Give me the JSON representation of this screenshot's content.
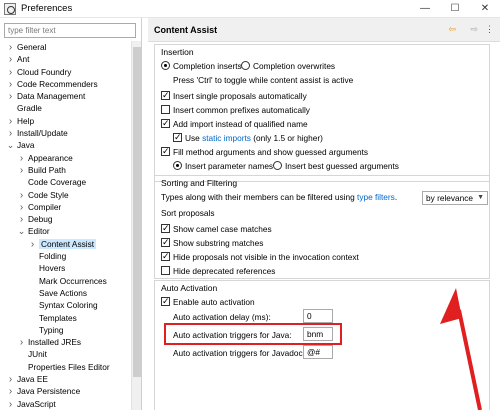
{
  "window": {
    "title": "Preferences",
    "minimize": "—",
    "maximize": "☐",
    "close": "✕"
  },
  "sidebar": {
    "filter_placeholder": "type filter text",
    "items": [
      {
        "label": "General",
        "arrow": "expand",
        "indent": 0
      },
      {
        "label": "Ant",
        "arrow": "expand",
        "indent": 0
      },
      {
        "label": "Cloud Foundry",
        "arrow": "expand",
        "indent": 0
      },
      {
        "label": "Code Recommenders",
        "arrow": "expand",
        "indent": 0
      },
      {
        "label": "Data Management",
        "arrow": "expand",
        "indent": 0
      },
      {
        "label": "Gradle",
        "arrow": "none",
        "indent": 0
      },
      {
        "label": "Help",
        "arrow": "expand",
        "indent": 0
      },
      {
        "label": "Install/Update",
        "arrow": "expand",
        "indent": 0
      },
      {
        "label": "Java",
        "arrow": "collapse",
        "indent": 0
      },
      {
        "label": "Appearance",
        "arrow": "expand",
        "indent": 1
      },
      {
        "label": "Build Path",
        "arrow": "expand",
        "indent": 1
      },
      {
        "label": "Code Coverage",
        "arrow": "none",
        "indent": 1
      },
      {
        "label": "Code Style",
        "arrow": "expand",
        "indent": 1
      },
      {
        "label": "Compiler",
        "arrow": "expand",
        "indent": 1
      },
      {
        "label": "Debug",
        "arrow": "expand",
        "indent": 1
      },
      {
        "label": "Editor",
        "arrow": "collapse",
        "indent": 1
      },
      {
        "label": "Content Assist",
        "arrow": "expand",
        "indent": 2,
        "selected": true
      },
      {
        "label": "Folding",
        "arrow": "none",
        "indent": 2
      },
      {
        "label": "Hovers",
        "arrow": "none",
        "indent": 2
      },
      {
        "label": "Mark Occurrences",
        "arrow": "none",
        "indent": 2
      },
      {
        "label": "Save Actions",
        "arrow": "none",
        "indent": 2
      },
      {
        "label": "Syntax Coloring",
        "arrow": "none",
        "indent": 2
      },
      {
        "label": "Templates",
        "arrow": "none",
        "indent": 2
      },
      {
        "label": "Typing",
        "arrow": "none",
        "indent": 2
      },
      {
        "label": "Installed JREs",
        "arrow": "expand",
        "indent": 1
      },
      {
        "label": "JUnit",
        "arrow": "none",
        "indent": 1
      },
      {
        "label": "Properties Files Editor",
        "arrow": "none",
        "indent": 1
      },
      {
        "label": "Java EE",
        "arrow": "expand",
        "indent": 0
      },
      {
        "label": "Java Persistence",
        "arrow": "expand",
        "indent": 0
      },
      {
        "label": "JavaScript",
        "arrow": "expand",
        "indent": 0
      }
    ]
  },
  "page": {
    "title": "Content Assist",
    "nav_back": "⇦",
    "nav_forward": "⇨",
    "nav_menu": "⋮"
  },
  "insertion": {
    "title": "Insertion",
    "completion_inserts": "Completion inserts",
    "completion_overwrites": "Completion overwrites",
    "toggle_hint": "Press 'Ctrl' to toggle while content assist is active",
    "insert_single": "Insert single proposals automatically",
    "insert_common": "Insert common prefixes automatically",
    "add_import": "Add import instead of qualified name",
    "use_static_prefix": "Use",
    "static_imports_link": "static imports",
    "use_static_suffix": "(only 1.5 or higher)",
    "fill_method": "Fill method arguments and show guessed arguments",
    "insert_param_names": "Insert parameter names",
    "insert_best_guessed": "Insert best guessed arguments"
  },
  "sorting": {
    "title": "Sorting and Filtering",
    "types_prefix": "Types along with their members can be filtered using",
    "type_filters_link": "type filters",
    "types_suffix": ".",
    "sort_proposals": "Sort proposals",
    "sort_value": "by relevance",
    "show_camel": "Show camel case matches",
    "show_substring": "Show substring matches",
    "hide_proposals": "Hide proposals not visible in the invocation context",
    "hide_deprecated": "Hide deprecated references"
  },
  "auto_activation": {
    "title": "Auto Activation",
    "enable": "Enable auto activation",
    "delay_label": "Auto activation delay (ms):",
    "delay_value": "0",
    "java_triggers_label": "Auto activation triggers for Java:",
    "java_triggers_value": "bnm",
    "javadoc_triggers_label": "Auto activation triggers for Javadoc:",
    "javadoc_triggers_value": "@#"
  },
  "colors": {
    "highlight": "#e02020",
    "link": "#0066cc",
    "selection": "#cce8ff"
  }
}
